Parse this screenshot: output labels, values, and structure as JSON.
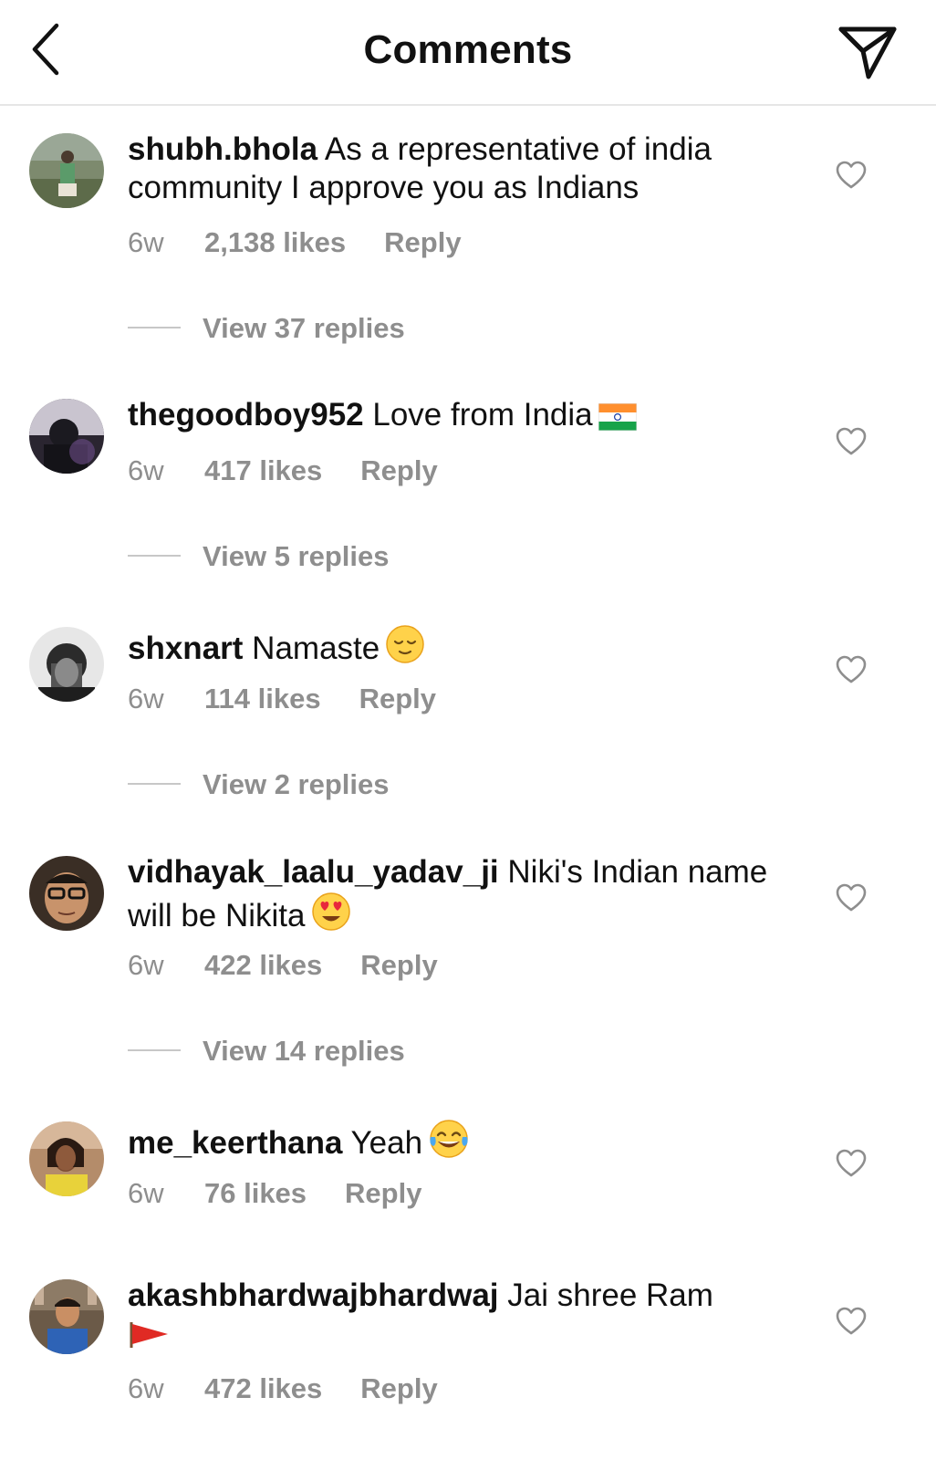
{
  "header": {
    "title": "Comments"
  },
  "comments": [
    {
      "username": "shubh.bhola",
      "text": "As a representative of india community I approve you as Indians",
      "time": "6w",
      "likes": "2,138 likes",
      "reply": "Reply",
      "view_replies": "View 37 replies"
    },
    {
      "username": "thegoodboy952",
      "text": "Love from India",
      "emoji": "flag-india-icon",
      "time": "6w",
      "likes": "417 likes",
      "reply": "Reply",
      "view_replies": "View 5 replies"
    },
    {
      "username": "shxnart",
      "text": "Namaste",
      "emoji": "relieved-face-icon",
      "time": "6w",
      "likes": "114 likes",
      "reply": "Reply",
      "view_replies": "View 2 replies"
    },
    {
      "username": "vidhayak_laalu_yadav_ji",
      "text": "Niki's Indian name will be Nikita",
      "emoji": "heart-eyes-face-icon",
      "time": "6w",
      "likes": "422 likes",
      "reply": "Reply",
      "view_replies": "View 14 replies"
    },
    {
      "username": "me_keerthana",
      "text": "Yeah",
      "emoji": "tears-of-joy-face-icon",
      "time": "6w",
      "likes": "76 likes",
      "reply": "Reply"
    },
    {
      "username": "akashbhardwajbhardwaj",
      "text": "Jai shree Ram",
      "emoji": "red-pennant-flag-icon",
      "time": "6w",
      "likes": "472 likes",
      "reply": "Reply"
    }
  ],
  "colors": {
    "text_primary": "#111111",
    "text_secondary": "#8e8e8e",
    "divider": "#e6e6e6"
  }
}
